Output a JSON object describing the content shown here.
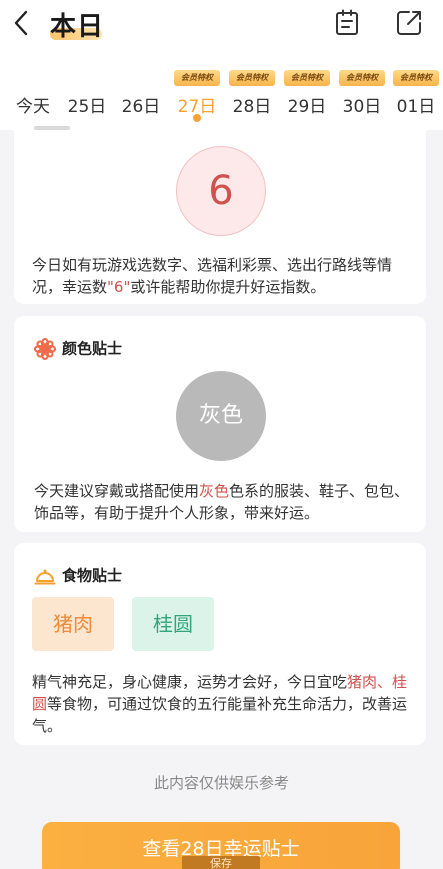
{
  "header": {
    "title": "本日",
    "back_icon": "chevron-left-icon",
    "calendar_icon": "calendar-list-icon",
    "share_icon": "external-link-icon"
  },
  "dates": [
    {
      "label": "今天",
      "tag": ""
    },
    {
      "label": "25日",
      "tag": ""
    },
    {
      "label": "26日",
      "tag": ""
    },
    {
      "label": "27日",
      "tag": "会员特权",
      "active": true
    },
    {
      "label": "28日",
      "tag": "会员特权"
    },
    {
      "label": "29日",
      "tag": "会员特权"
    },
    {
      "label": "30日",
      "tag": "会员特权"
    },
    {
      "label": "01日",
      "tag": "会员特权"
    }
  ],
  "lucky_number": {
    "number": "6",
    "text_before": "今日如有玩游戏选数字、选福利彩票、选出行路线等情况，幸运数",
    "text_highlight": "\"6\"",
    "text_after": "或许能帮助你提升好运指数。"
  },
  "color_tip": {
    "title": "颜色贴士",
    "color_name": "灰色",
    "text_before": "今天建议穿戴或搭配使用",
    "text_highlight": "灰色",
    "text_after": "色系的服装、鞋子、包包、饰品等，有助于提升个人形象，带来好运。"
  },
  "food_tip": {
    "title": "食物贴士",
    "foods": [
      "猪肉",
      "桂圆"
    ],
    "text_before": "精气神充足，身心健康，运势才会好，今日宜吃",
    "highlight1": "猪肉",
    "sep": "、",
    "highlight2": "桂圆",
    "text_after": "等食物，可通过饮食的五行能量补充生命活力，改善运气。"
  },
  "disclaimer": "此内容仅供娱乐参考",
  "cta": {
    "label": "查看28日幸运贴士",
    "sub": "保存"
  },
  "colors": {
    "accent": "#f7a233",
    "highlight_red": "#d0524e",
    "gray_circle": "#b9b9b9"
  }
}
